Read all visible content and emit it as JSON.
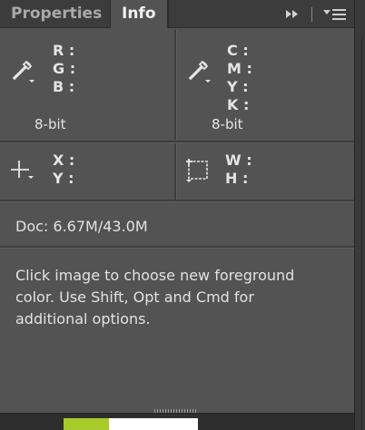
{
  "tabs": [
    {
      "label": "Properties",
      "active": false
    },
    {
      "label": "Info",
      "active": true
    }
  ],
  "controls": {
    "collapse_icon": "double-arrow-right",
    "menu_icon": "panel-menu"
  },
  "color_readout_left": {
    "icon": "eyedropper",
    "labels": [
      "R :",
      "G :",
      "B :"
    ],
    "bit_depth": "8-bit"
  },
  "color_readout_right": {
    "icon": "eyedropper",
    "labels": [
      "C :",
      "M :",
      "Y :",
      "K :"
    ],
    "bit_depth": "8-bit"
  },
  "position_readout": {
    "icon": "crosshair",
    "labels": [
      "X :",
      "Y :"
    ]
  },
  "size_readout": {
    "icon": "marquee-rectangle",
    "labels": [
      "W :",
      "H :"
    ]
  },
  "doc_info": "Doc: 6.67M/43.0M",
  "help_text": "Click image to choose new foreground\ncolor.  Use Shift, Opt and Cmd for\nadditional options.",
  "colors": {
    "panel_bg": "#535353",
    "tabbar_bg": "#3c3c3c",
    "text": "#e2e2e2",
    "swatch_green": "#a7cb2a",
    "swatch_white": "#ffffff"
  }
}
